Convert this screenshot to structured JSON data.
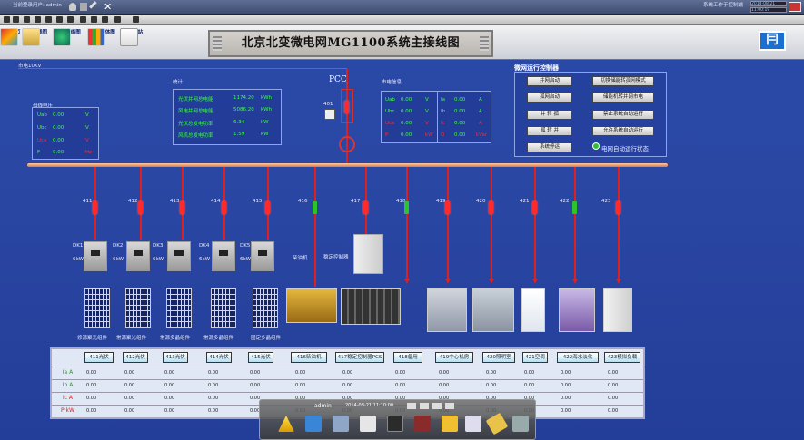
{
  "window": {
    "top_left_text": "当前登录用户: admin",
    "top_right_text": "系统工作于控制端",
    "datetime": "2014-08-21",
    "time": "11:00:19"
  },
  "nav": [
    {
      "label": "首页"
    },
    {
      "label": "主接线图"
    },
    {
      "label": "通讯网络图"
    },
    {
      "label": "电压总体图"
    },
    {
      "label": "气象站"
    }
  ],
  "title": "北京北变微电网MG1100系统主接线图",
  "grid_label": "市电10KV",
  "pcc_label": "PCC",
  "pcc_switch": "401",
  "busbar_voltage_panel": {
    "title": "母线电压",
    "rows": [
      {
        "name": "Uab",
        "value": "0.00",
        "unit": "V"
      },
      {
        "name": "Ubc",
        "value": "0.00",
        "unit": "V"
      },
      {
        "name": "Uca",
        "value": "0.00",
        "unit": "V"
      },
      {
        "name": "F",
        "value": "0.00",
        "unit": "Hz"
      }
    ]
  },
  "stats_panel": {
    "title": "统计",
    "rows": [
      {
        "name": "光伏并网总电能",
        "value": "1174.20",
        "unit": "kWh"
      },
      {
        "name": "风电并网总电能",
        "value": "5086.20",
        "unit": "kWh"
      },
      {
        "name": "光伏总发电功率",
        "value": "6.34",
        "unit": "kW"
      },
      {
        "name": "风机总发电功率",
        "value": "1.59",
        "unit": "kW"
      }
    ]
  },
  "grid_info_panel": {
    "title": "市电信息",
    "left": [
      {
        "name": "Uab",
        "value": "0.00",
        "unit": "V"
      },
      {
        "name": "Ubc",
        "value": "0.00",
        "unit": "V"
      },
      {
        "name": "Uca",
        "value": "0.00",
        "unit": "V"
      },
      {
        "name": "P",
        "value": "0.00",
        "unit": "kW"
      }
    ],
    "right": [
      {
        "name": "Ia",
        "value": "0.00",
        "unit": "A"
      },
      {
        "name": "Ib",
        "value": "0.00",
        "unit": "A"
      },
      {
        "name": "Ic",
        "value": "0.00",
        "unit": "A"
      },
      {
        "name": "Q",
        "value": "0.00",
        "unit": "kVar"
      }
    ]
  },
  "controller": {
    "title": "微网运行控制器",
    "buttons_left": [
      "并网启动",
      "孤网启动",
      "并 转 孤",
      "孤 转 并",
      "系统停运"
    ],
    "buttons_right": [
      "切换储能转孤网模式",
      "储能机转并网市电",
      "禁止系统自动运行",
      "允许系统自动运行"
    ],
    "status_label": "电网自动运行状态"
  },
  "feeders": [
    {
      "id": "411",
      "state": "red"
    },
    {
      "id": "412",
      "state": "red"
    },
    {
      "id": "413",
      "state": "red"
    },
    {
      "id": "414",
      "state": "red"
    },
    {
      "id": "415",
      "state": "red"
    },
    {
      "id": "416",
      "state": "green"
    },
    {
      "id": "417",
      "state": "red"
    },
    {
      "id": "418",
      "state": "green"
    },
    {
      "id": "419",
      "state": "red"
    },
    {
      "id": "420",
      "state": "red"
    },
    {
      "id": "421",
      "state": "red"
    },
    {
      "id": "422",
      "state": "green"
    },
    {
      "id": "423",
      "state": "red"
    }
  ],
  "inverters": [
    {
      "name": "DK1",
      "sub": "6kW"
    },
    {
      "name": "DK2",
      "sub": "6kW"
    },
    {
      "name": "DK3",
      "sub": "6kW"
    },
    {
      "name": "DK4",
      "sub": "6kW"
    },
    {
      "name": "DK5",
      "sub": "6kW"
    }
  ],
  "pv_labels": [
    "修源聚光组件",
    "常源多晶组件",
    "常源聚光组件",
    "常源多晶组件",
    "固定多晶组件"
  ],
  "diesel_label": "柴油机",
  "storage_label": "稳定控制器",
  "table": {
    "headers": [
      "411光伏",
      "412光伏",
      "413光伏",
      "414光伏",
      "415光伏",
      "416柴油机",
      "417稳定控制器PCS",
      "418备用",
      "419中心机房",
      "420照明室",
      "421空调",
      "422海水淡化",
      "423模拟负载"
    ],
    "row_labels": [
      "Ia A",
      "Ib A",
      "Ic A",
      "P kW"
    ],
    "values": [
      "0.00",
      "0.00",
      "0.00",
      "0.00",
      "0.00",
      "0.00",
      "0.00",
      "0.00",
      "0.00",
      "0.00",
      "0.00",
      "0.00",
      "0.00"
    ]
  },
  "dock": {
    "user": "admin",
    "datetime": "2014-08-21 11:10:00"
  },
  "colors": {
    "background": "#2a47a4",
    "closed_switch": "#ff2a2a",
    "open_switch": "#2ec22e",
    "value_text": "#3cff3c",
    "busbar": "#d87a44"
  }
}
